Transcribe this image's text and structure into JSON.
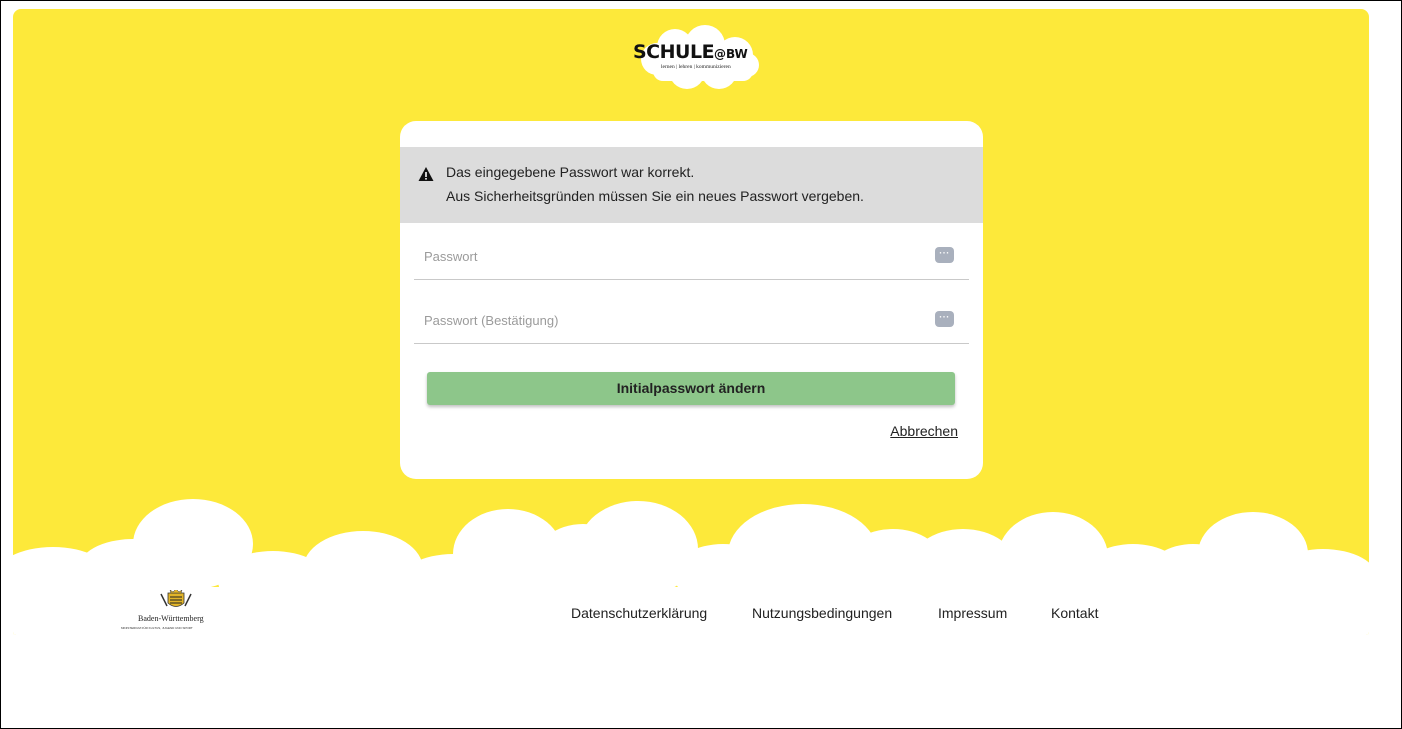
{
  "logo": {
    "title": "SCHULE",
    "title_suffix": "@BW",
    "tagline": "lernen | lehren | kommunizieren"
  },
  "notice": {
    "line1": "Das eingegebene Passwort war korrekt.",
    "line2": "Aus Sicherheitsgründen müssen Sie ein neues Passwort vergeben.",
    "icon": "warning-icon"
  },
  "form": {
    "password_placeholder": "Passwort",
    "password_value": "",
    "confirm_placeholder": "Passwort (Bestätigung)",
    "confirm_value": "",
    "password_icon": "password-manager-icon",
    "submit_label": "Initialpasswort ändern",
    "cancel_label": "Abbrechen"
  },
  "footer": {
    "state_name": "Baden-Württemberg",
    "ministry": "MINISTERIUM FÜR KULTUS, JUGEND UND SPORT",
    "links": [
      "Datenschutzerklärung",
      "Nutzungsbedingungen",
      "Impressum",
      "Kontakt"
    ]
  },
  "colors": {
    "background": "#fde93a",
    "submit_button": "#8dc68a",
    "notice_background": "#dcdcdc"
  }
}
